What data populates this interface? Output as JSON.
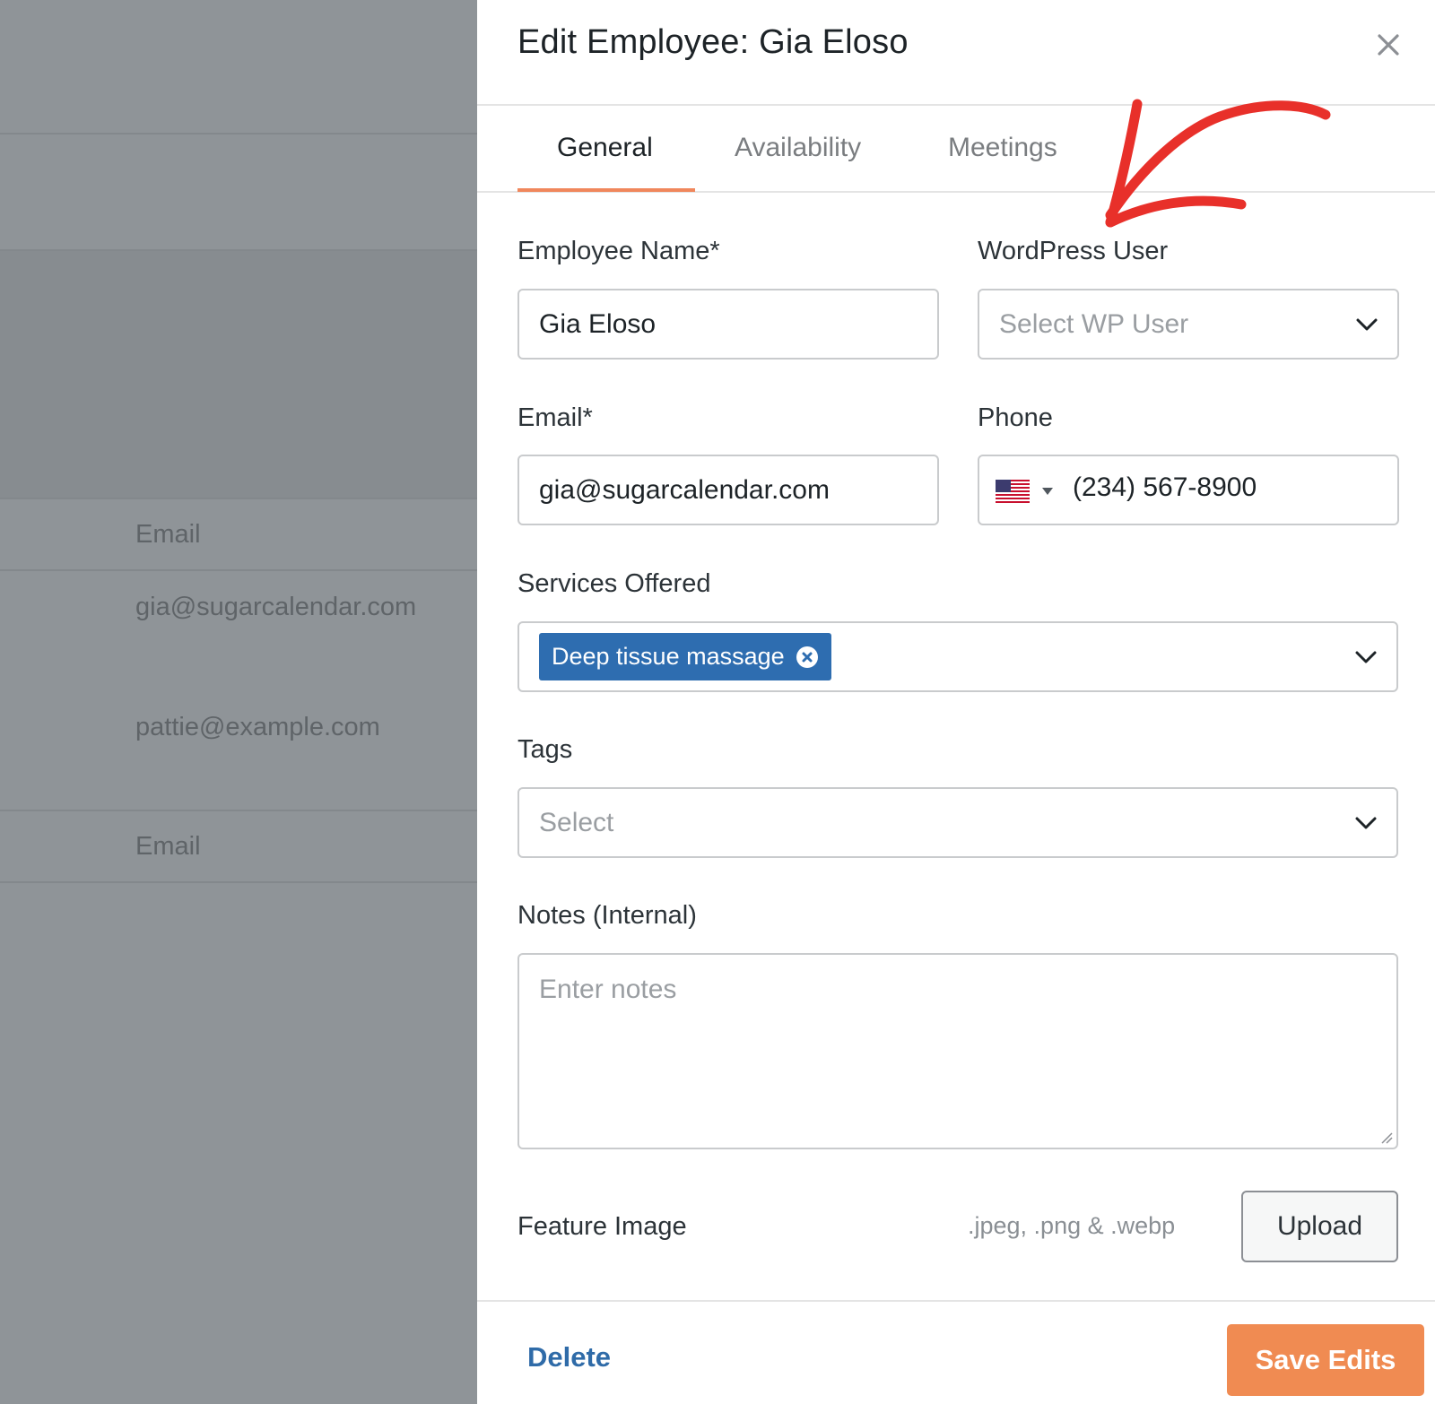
{
  "background": {
    "rows": [
      {
        "text": "Email"
      },
      {
        "text": "gia@sugarcalendar.com"
      },
      {
        "text": "pattie@example.com"
      },
      {
        "text": "Email"
      }
    ]
  },
  "panel": {
    "title": "Edit Employee: Gia Eloso",
    "close_icon": "close-icon",
    "tabs": [
      {
        "label": "General",
        "active": true
      },
      {
        "label": "Availability",
        "active": false
      },
      {
        "label": "Meetings",
        "active": false
      }
    ]
  },
  "form": {
    "employee_name": {
      "label": "Employee Name*",
      "value": "Gia Eloso"
    },
    "wordpress_user": {
      "label": "WordPress User",
      "placeholder": "Select WP User"
    },
    "email": {
      "label": "Email*",
      "value": "gia@sugarcalendar.com"
    },
    "phone": {
      "label": "Phone",
      "country_icon": "us-flag-icon",
      "value": "(234) 567-8900"
    },
    "services": {
      "label": "Services Offered",
      "selected": [
        {
          "label": "Deep tissue massage"
        }
      ]
    },
    "tags": {
      "label": "Tags",
      "placeholder": "Select"
    },
    "notes": {
      "label": "Notes (Internal)",
      "placeholder": "Enter notes"
    },
    "feature_image": {
      "label": "Feature Image",
      "hint": ".jpeg, .png & .webp",
      "upload_label": "Upload"
    }
  },
  "footer": {
    "delete_label": "Delete",
    "save_label": "Save Edits"
  },
  "colors": {
    "accent": "#f08b52",
    "tab_underline": "#f0875c",
    "link": "#2f6ba8",
    "chip": "#2e6db0",
    "annotation_arrow": "#e8302a",
    "overlay": "#8f9498"
  }
}
